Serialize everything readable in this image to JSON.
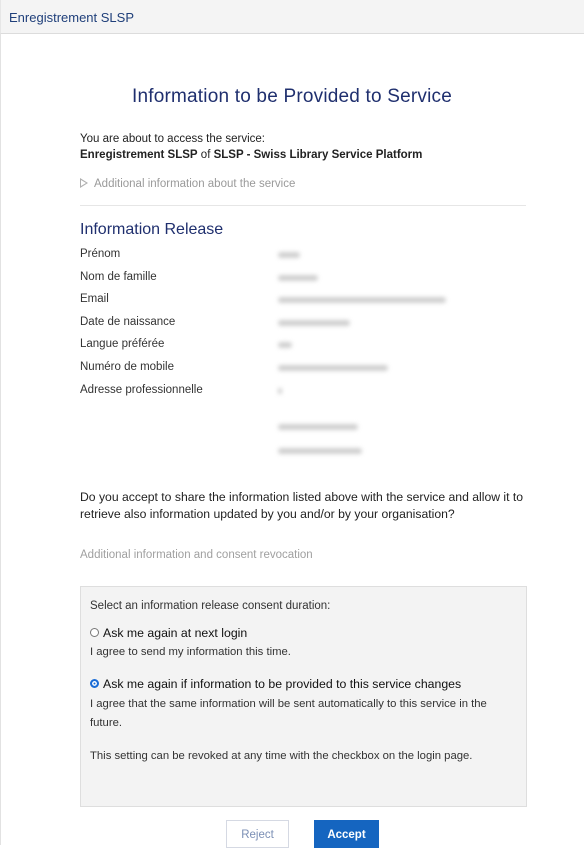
{
  "header": {
    "brand": "Enregistrement SLSP"
  },
  "page": {
    "title": "Information to be Provided to Service",
    "intro_line": "You are about to access the service:",
    "service_name": "Enregistrement SLSP",
    "of_word": "of",
    "service_org": "SLSP - Swiss Library Service Platform",
    "additional_info": "Additional information about the service"
  },
  "release": {
    "title": "Information Release",
    "attributes": [
      {
        "label": "Prénom"
      },
      {
        "label": "Nom de famille"
      },
      {
        "label": "Email"
      },
      {
        "label": "Date de naissance"
      },
      {
        "label": "Langue préférée"
      },
      {
        "label": "Numéro de mobile"
      },
      {
        "label": "Adresse professionnelle"
      }
    ]
  },
  "consent": {
    "question": "Do you accept to share the information listed above with the service and allow it to retrieve also information updated by you and/or by your organisation?",
    "revocation_link": "Additional information and consent revocation",
    "duration_prompt": "Select an information release consent duration:",
    "options": [
      {
        "label": "Ask me again at next login",
        "desc": "I agree to send my information this time.",
        "selected": false
      },
      {
        "label": "Ask me again if information to be provided to this service changes",
        "desc": "I agree that the same information will be sent automatically to this service in the future.",
        "selected": true
      }
    ],
    "note": "This setting can be revoked at any time with the checkbox on the login page."
  },
  "buttons": {
    "reject": "Reject",
    "accept": "Accept"
  },
  "colors": {
    "title": "#1f2f6e",
    "accept_bg": "#1565c0",
    "radio_selected": "#1a6cd6"
  }
}
